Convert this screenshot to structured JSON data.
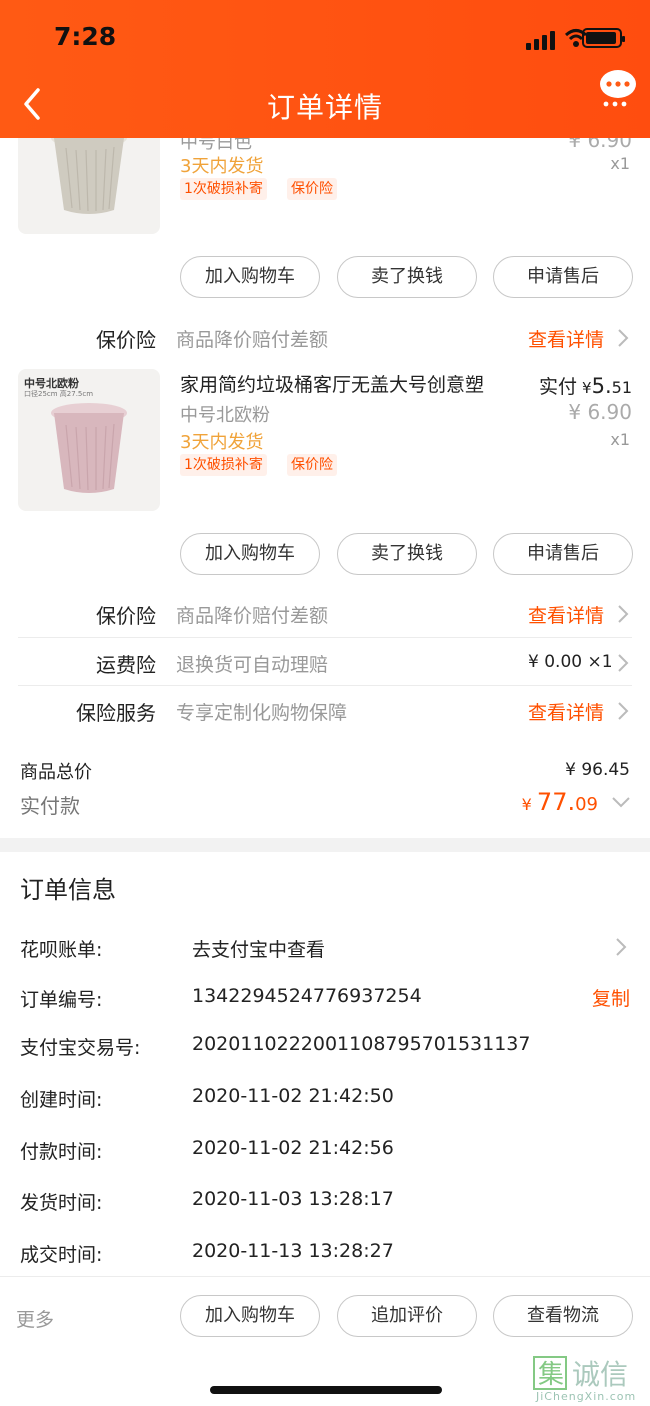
{
  "status_bar": {
    "time": "7:28"
  },
  "header": {
    "title": "订单详情"
  },
  "items": [
    {
      "spec": "中号白色",
      "orig_price": "¥ 6.90",
      "qty": "x1",
      "shipping": "3天内发货",
      "tags": [
        "1次破损补寄",
        "保价险"
      ],
      "bucket_color": "#cfcbc0"
    },
    {
      "thumb_label": "中号北欧粉",
      "thumb_sub": "口径25cm 高27.5cm",
      "name": "家用简约垃圾桶客厅无盖大号创意塑",
      "paid_label": "实付",
      "paid_currency": "¥",
      "paid_int": "5.",
      "paid_dec": "51",
      "orig_price": "¥ 6.90",
      "spec": "中号北欧粉",
      "qty": "x1",
      "shipping": "3天内发货",
      "tags": [
        "1次破损补寄",
        "保价险"
      ],
      "bucket_color": "#d8b7bd"
    }
  ],
  "item_buttons": [
    "加入购物车",
    "卖了换钱",
    "申请售后"
  ],
  "price_protect": {
    "label": "保价险",
    "desc": "商品降价赔付差额",
    "action": "查看详情"
  },
  "shipping_ins": {
    "label": "运费险",
    "desc": "退换货可自动理赔",
    "value": "¥ 0.00 ×1"
  },
  "ins_service": {
    "label": "保险服务",
    "desc": "专享定制化购物保障",
    "action": "查看详情"
  },
  "totals": {
    "goods_label": "商品总价",
    "goods_value": "¥ 96.45",
    "paid_label": "实付款",
    "paid_currency": "¥",
    "paid_int": "77.",
    "paid_dec": "09"
  },
  "order_info": {
    "title": "订单信息",
    "rows": [
      {
        "label": "花呗账单:",
        "value": "去支付宝中查看"
      },
      {
        "label": "订单编号:",
        "value": "1342294524776937254",
        "action": "复制"
      },
      {
        "label": "支付宝交易号:",
        "value": "2020110222001108795701531137"
      },
      {
        "label": "创建时间:",
        "value": "2020-11-02 21:42:50"
      },
      {
        "label": "付款时间:",
        "value": "2020-11-02 21:42:56"
      },
      {
        "label": "发货时间:",
        "value": "2020-11-03 13:28:17"
      },
      {
        "label": "成交时间:",
        "value": "2020-11-13 13:28:27"
      }
    ]
  },
  "bottom_bar": {
    "more": "更多",
    "buttons": [
      "加入购物车",
      "追加评价",
      "查看物流"
    ]
  },
  "watermark": {
    "text": "JiChengXin.com",
    "chars": "集诚信"
  },
  "colors": {
    "accent": "#ff5000",
    "header": "#ff5a14",
    "shipping": "#f0a33a"
  }
}
